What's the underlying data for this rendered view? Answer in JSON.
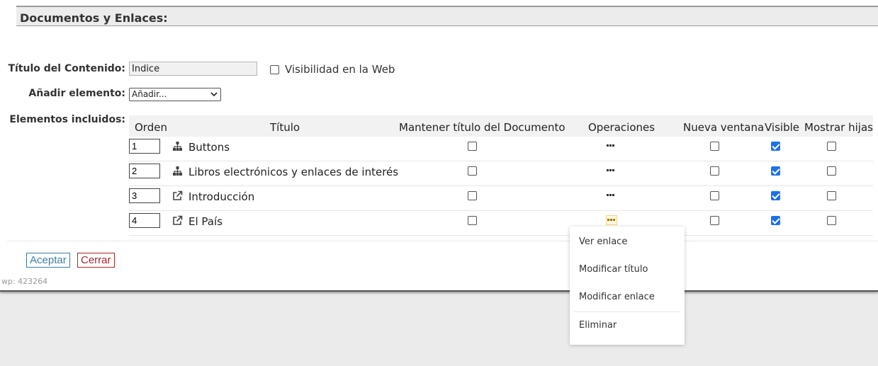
{
  "section": {
    "title": "Documentos y Enlaces:"
  },
  "form": {
    "content_title_label": "Título del Contenido:",
    "content_title_value": "Índice",
    "web_visibility_label": "Visibilidad en la Web",
    "web_visibility_checked": false,
    "add_element_label": "Añadir elemento:",
    "add_element_selected": "Añadir...",
    "included_elements_label": "Elementos incluidos:"
  },
  "table": {
    "headers": {
      "order": "Orden",
      "title": "Título",
      "keep_title": "Mantener título del Documento",
      "operations": "Operaciones",
      "new_window": "Nueva ventana",
      "visible": "Visible",
      "show_children": "Mostrar hijas"
    },
    "rows": [
      {
        "order": "1",
        "icon": "sitemap-icon",
        "title": "Buttons",
        "keep_title": false,
        "new_window": false,
        "visible": true,
        "show_children": false
      },
      {
        "order": "2",
        "icon": "sitemap-icon",
        "title": "Libros electrónicos y enlaces de interés",
        "keep_title": false,
        "new_window": false,
        "visible": true,
        "show_children": false
      },
      {
        "order": "3",
        "icon": "external-link-icon",
        "title": "Introducción",
        "keep_title": false,
        "new_window": false,
        "visible": true,
        "show_children": false
      },
      {
        "order": "4",
        "icon": "external-link-icon",
        "title": "El País",
        "keep_title": false,
        "new_window": false,
        "visible": true,
        "show_children": false
      }
    ]
  },
  "buttons": {
    "accept": "Aceptar",
    "close": "Cerrar"
  },
  "footer": {
    "wp_id": "wp: 423264"
  },
  "context_menu": {
    "items": [
      "Ver enlace",
      "Modificar título",
      "Modificar enlace",
      "Eliminar"
    ]
  },
  "colors": {
    "accept": "#3b7ea8",
    "close": "#a8282b",
    "checkbox_checked": "#1a73e8",
    "header_bg": "#ececec"
  }
}
